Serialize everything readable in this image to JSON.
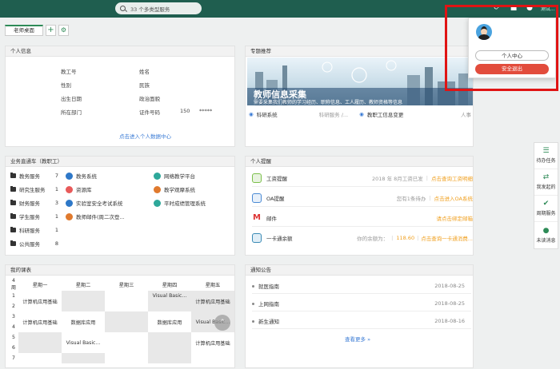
{
  "search": {
    "text": "33 个多类型服务"
  },
  "top": {
    "user_text": "测试..."
  },
  "tabs": {
    "home": "老师桌面"
  },
  "personal": {
    "title": "个人信息",
    "labels": [
      "教工号",
      "性别",
      "出生日期",
      "所在部门",
      "姓名",
      "民族",
      "政治面貌",
      "证件号码"
    ],
    "id_value_a": "150",
    "id_value_b": "*****",
    "link": "点击进入个人数据中心"
  },
  "topic": {
    "title": "专题推荐",
    "banner_title": "教师信息采集",
    "banner_sub": "需要采集我们教师的学习经历、职称信息、工人履历、教师资格等信息",
    "row": [
      "科研系统",
      "科研服务 /...",
      "教职工信息变更",
      "人事"
    ]
  },
  "business": {
    "title": "业务直通车（教职工）",
    "categories": [
      {
        "name": "教务服务",
        "count": "7"
      },
      {
        "name": "研究生服务",
        "count": "1"
      },
      {
        "name": "财务服务",
        "count": "3"
      },
      {
        "name": "学生服务",
        "count": "1"
      },
      {
        "name": "科研服务",
        "count": "1"
      },
      {
        "name": "公共服务",
        "count": "8"
      }
    ],
    "systems_a": [
      "教务系统",
      "资源库",
      "实验室安全考试系统",
      "教师邮件(周二次登..."
    ],
    "systems_b": [
      "网络教学平台",
      "教学观摩系统",
      "平时成绩管理系统"
    ]
  },
  "reminders": {
    "title": "个人提醒",
    "rows": [
      {
        "name": "工资提醒",
        "info": "2018 年 8月工资已发",
        "action": "点击查询工资明细"
      },
      {
        "name": "OA提醒",
        "info": "您有1条待办",
        "action": "点击进入OA系统"
      },
      {
        "name": "邮件",
        "info": "",
        "action": "请点击绑定邮箱"
      },
      {
        "name": "一卡通余额",
        "info": "你的余额为：",
        "amount": "118.60",
        "action": "点击查询一卡通消费..."
      }
    ]
  },
  "schedule": {
    "title": "我的课表",
    "week": "4周",
    "days": [
      "星期一",
      "星期二",
      "星期三",
      "星期四",
      "星期五"
    ],
    "periods": [
      "1",
      "2",
      "3",
      "4",
      "5",
      "6",
      "7"
    ],
    "cells": {
      "r2c1": "计算机应用基础",
      "r1c4": "Visual Basic...",
      "r2c5": "计算机应用基础",
      "r4c1": "计算机应用基础",
      "r4c2": "数据库应用",
      "r4c4": "数据库应用",
      "r4c5": "Visual Basic...",
      "r6c2": "Visual Basic...",
      "r6c5": "计算机应用基础"
    }
  },
  "notices": {
    "title": "通知公告",
    "rows": [
      {
        "name": "就医指南",
        "date": "2018-08-25"
      },
      {
        "name": "上网指南",
        "date": "2018-08-25"
      },
      {
        "name": "新生通知",
        "date": "2018-08-16"
      }
    ],
    "more": "查看更多 »"
  },
  "rightbar": [
    "待办任务",
    "我发起的",
    "周期服务",
    "未读消息"
  ],
  "popup": {
    "center": "个人中心",
    "logout": "安全退出"
  },
  "colors": {
    "header": "#1f5e4f",
    "accent": "#2e8b57",
    "danger": "#e24c3c",
    "link": "#3a7bd5",
    "orange": "#f0a020"
  }
}
